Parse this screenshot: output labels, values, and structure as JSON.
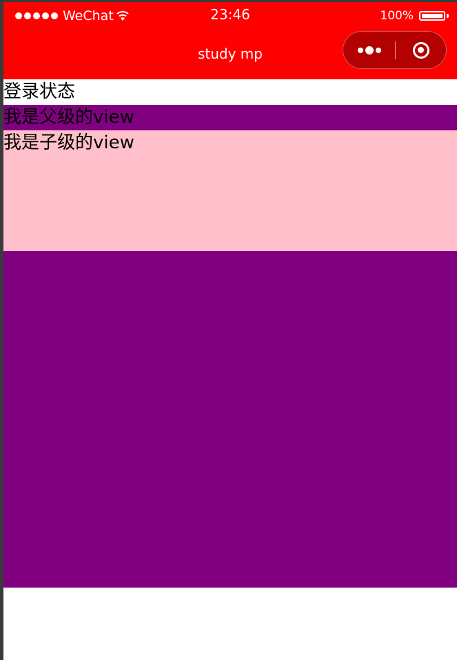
{
  "status_bar": {
    "carrier": "WeChat",
    "time": "23:46",
    "battery": "100%",
    "signal_icon": "signal-dots-icon",
    "wifi_icon": "wifi-icon",
    "battery_icon": "battery-icon"
  },
  "nav_bar": {
    "title": "study mp",
    "background_color": "#ff0000",
    "capsule_more_icon": "more-dots-icon",
    "capsule_close_icon": "target-close-icon"
  },
  "page": {
    "login_status": "登录状态",
    "parent_view": "我是父级的view",
    "child_view": "我是子级的view",
    "parent_color": "#800080",
    "child_color": "#ffc0cb"
  }
}
